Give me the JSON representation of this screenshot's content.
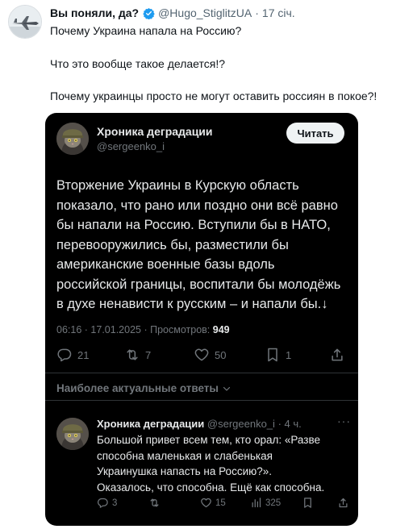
{
  "tweet": {
    "author_name": "Вы поняли, да?",
    "handle": "@Hugo_StiglitzUA",
    "separator": "·",
    "time": "17 січ.",
    "lines": [
      "Почему Украина напала на Россию?",
      "Что это вообще такое делается!?",
      "Почему украинцы просто не могут оставить россиян в покое?!"
    ]
  },
  "embedded": {
    "author_name": "Хроника деградации",
    "handle": "@sergeenko_i",
    "read_button": "Читать",
    "body_lines": [
      "Вторжение Украины в Курскую область",
      "показало, что рано или поздно они всё равно",
      "бы напали на Россию. Вступили бы в НАТО,",
      "перевооружились бы, разместили бы",
      "американские военные базы вдоль",
      "российской границы, воспитали бы молодёжь",
      "в духе ненависти к русским – и напали бы.↓"
    ],
    "meta": {
      "time": "06:16",
      "separator": "·",
      "date": "17.01.2025",
      "views_label": "Просмотров:",
      "views": "949"
    },
    "actions": {
      "replies": "21",
      "reposts": "7",
      "likes": "50",
      "bookmarks": "1"
    },
    "relevant_replies": "Наиболее актуальные ответы",
    "reply": {
      "author_name": "Хроника деградации",
      "handle": "@sergeenko_i",
      "separator": "·",
      "time": "4 ч.",
      "more": "···",
      "body_lines": [
        "Большой привет всем тем, кто орал: «Разве",
        "способна маленькая и слабенькая",
        "Украинушка напасть на Россию?».",
        "Оказалось, что способна. Ещё как способна."
      ],
      "actions": {
        "replies": "3",
        "likes": "15",
        "views": "325"
      }
    }
  },
  "colors": {
    "accent": "#1d9bf0",
    "card_bg": "#000000",
    "muted": "#71767b"
  }
}
